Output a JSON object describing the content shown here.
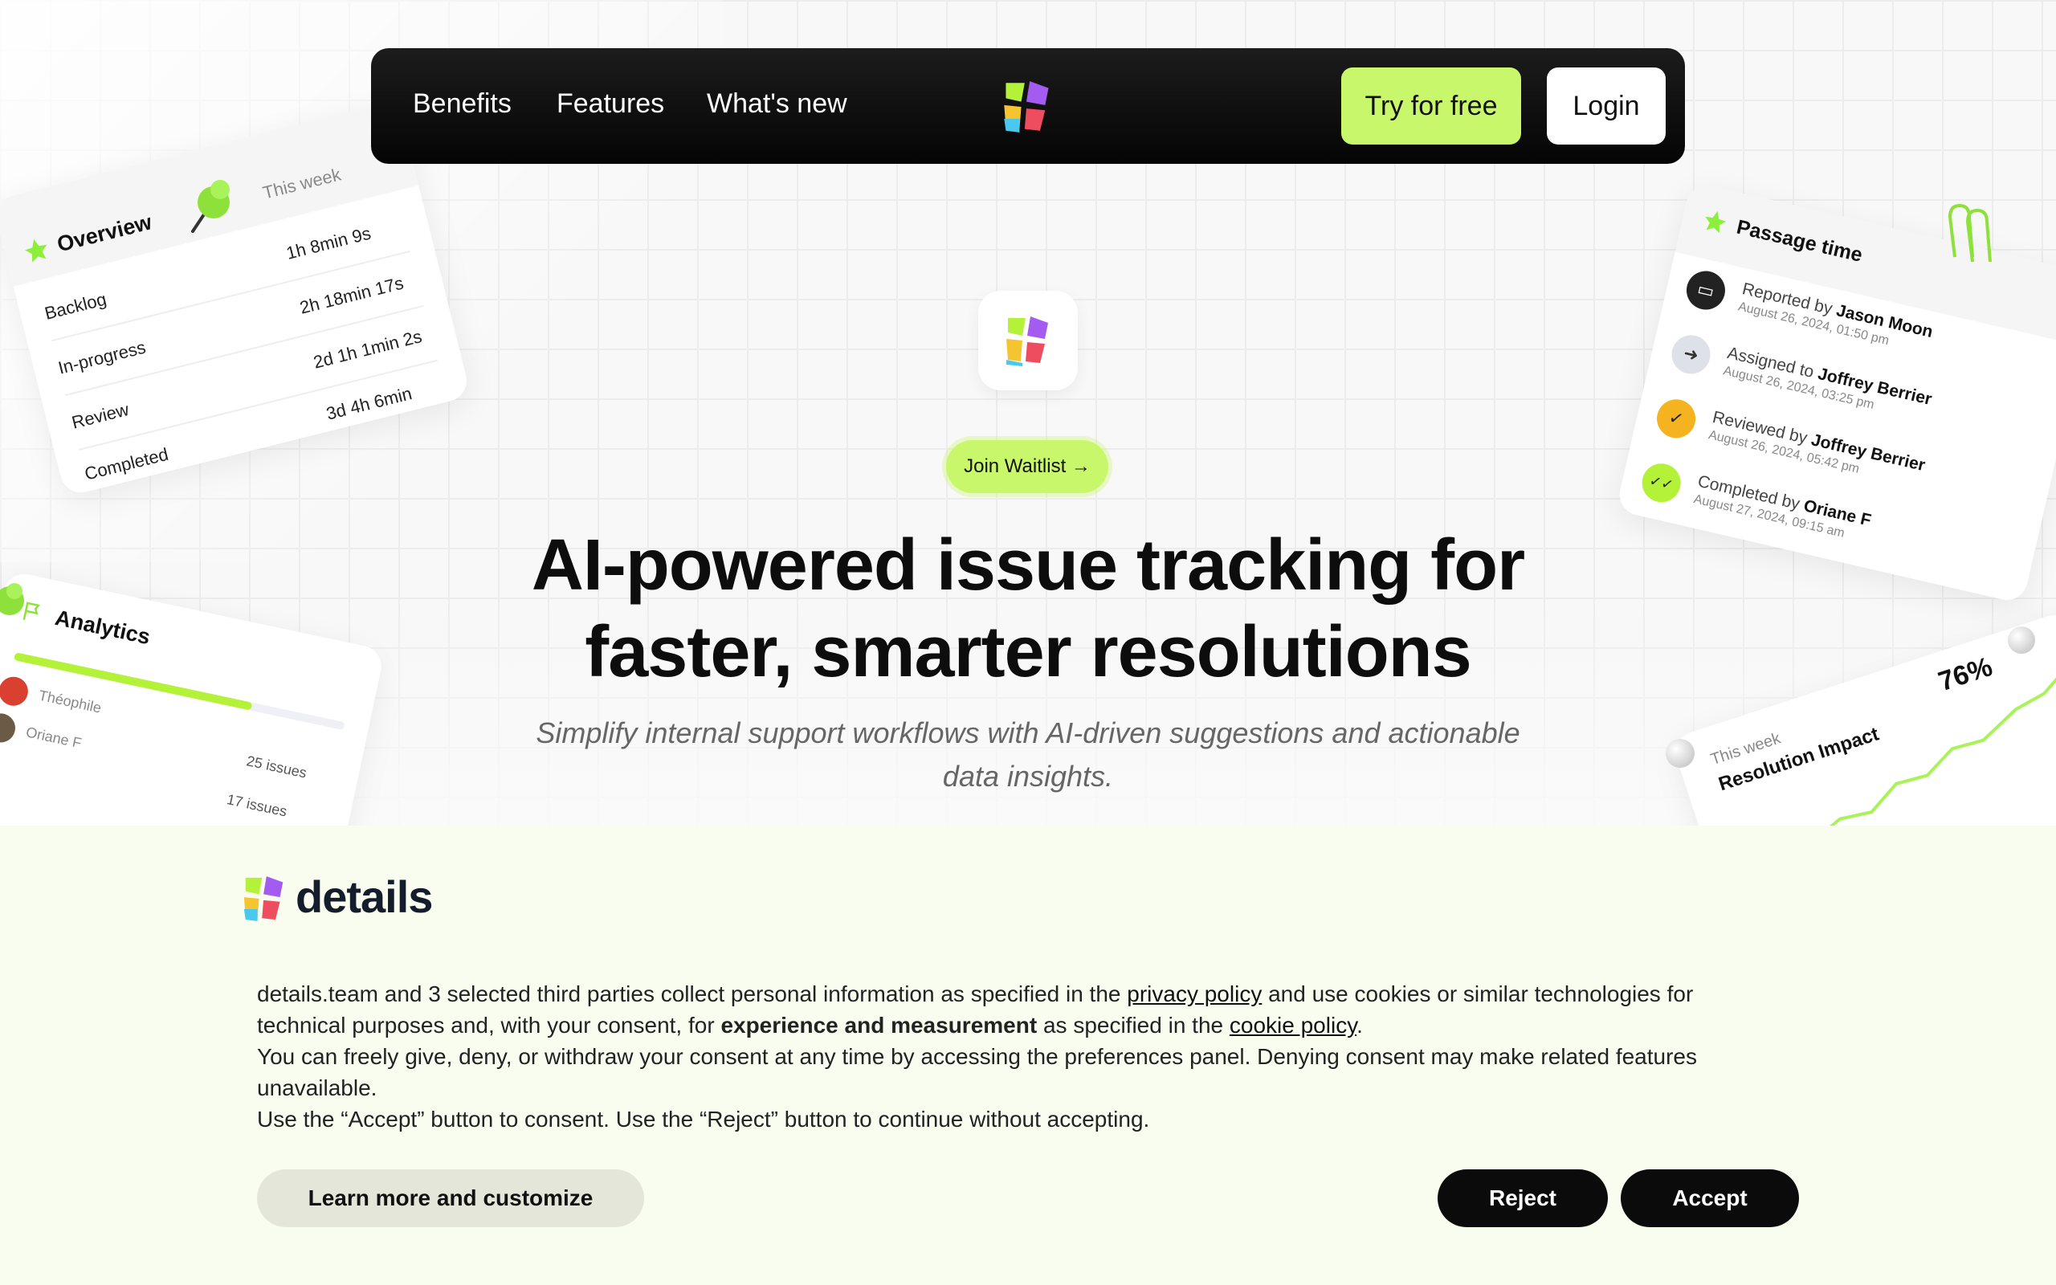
{
  "nav": {
    "links": [
      "Benefits",
      "Features",
      "What's new"
    ],
    "try_label": "Try for free",
    "login_label": "Login"
  },
  "hero": {
    "waitlist_label": "Join Waitlist →",
    "headline_line1": "AI-powered issue tracking for",
    "headline_line2": "faster, smarter resolutions",
    "subline_line1": "Simplify internal support workflows with AI-driven suggestions and actionable",
    "subline_line2": "data insights."
  },
  "overview_card": {
    "title": "Overview",
    "period": "This week",
    "rows": [
      {
        "label": "Backlog",
        "value": "1h 8min 9s"
      },
      {
        "label": "In-progress",
        "value": "2h 18min 17s"
      },
      {
        "label": "Review",
        "value": "2d 1h 1min 2s"
      },
      {
        "label": "Completed",
        "value": "3d 4h 6min"
      }
    ]
  },
  "analytics_card": {
    "title": "Analytics",
    "users": [
      {
        "name": "Théophile",
        "issues": "25 issues"
      },
      {
        "name": "Oriane F",
        "issues": "17 issues"
      }
    ],
    "progress": 0.72
  },
  "passage_card": {
    "title": "Passage time",
    "events": [
      {
        "action": "Reported by",
        "person": "Jason Moon",
        "date": "August 26, 2024, 01:50 pm"
      },
      {
        "action": "Assigned to",
        "person": "Joffrey Berrier",
        "date": "August 26, 2024, 03:25 pm"
      },
      {
        "action": "Reviewed by",
        "person": "Joffrey Berrier",
        "date": "August 26, 2024, 05:42 pm"
      },
      {
        "action": "Completed by",
        "person": "Oriane F",
        "date": "August 27, 2024, 09:15 am"
      }
    ]
  },
  "impact_card": {
    "period": "This week",
    "title": "Resolution Impact",
    "percent": "76%"
  },
  "cookie": {
    "brand": "details",
    "p1_a": "details.team and 3 selected third parties collect personal information as specified in the ",
    "p1_link": "privacy policy",
    "p1_b": " and use cookies or similar technologies for technical purposes and, with your consent, for ",
    "p1_bold": "experience and measurement",
    "p1_c": " as specified in the ",
    "p1_link2": "cookie policy",
    "p1_d": ".",
    "p2": "You can freely give, deny, or withdraw your consent at any time by accessing the preferences panel. Denying consent may make related features unavailable.",
    "p3": "Use the “Accept” button to consent. Use the “Reject” button to continue without accepting.",
    "learn_label": "Learn more and customize",
    "reject_label": "Reject",
    "accept_label": "Accept"
  },
  "colors": {
    "accent": "#c9f76b",
    "dark": "#0b0b0b",
    "banner_bg": "#f9fdf0"
  }
}
